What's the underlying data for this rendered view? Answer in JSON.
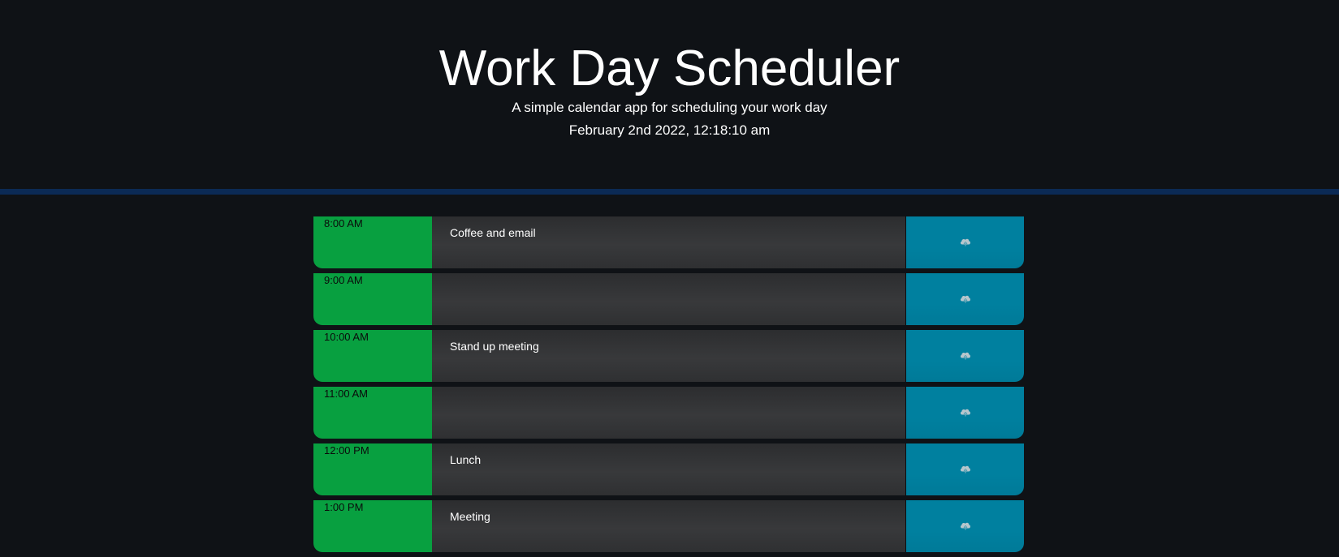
{
  "header": {
    "title": "Work Day Scheduler",
    "lead": "A simple calendar app for scheduling your work day",
    "current_day": "February 2nd 2022, 12:18:10 am"
  },
  "colors": {
    "background": "#0f1216",
    "divider": "#0b2a55",
    "hour_future": "#08a040",
    "description_bg": "#333436",
    "save_button": "#00809f"
  },
  "time_blocks": [
    {
      "hour": "8:00 AM",
      "description": "Coffee and email",
      "save_icon": "cloud-upload-icon"
    },
    {
      "hour": "9:00 AM",
      "description": "",
      "save_icon": "cloud-upload-icon"
    },
    {
      "hour": "10:00 AM",
      "description": "Stand up meeting",
      "save_icon": "cloud-upload-icon"
    },
    {
      "hour": "11:00 AM",
      "description": "",
      "save_icon": "cloud-upload-icon"
    },
    {
      "hour": "12:00 PM",
      "description": "Lunch",
      "save_icon": "cloud-upload-icon"
    },
    {
      "hour": "1:00 PM",
      "description": "Meeting",
      "save_icon": "cloud-upload-icon"
    }
  ]
}
